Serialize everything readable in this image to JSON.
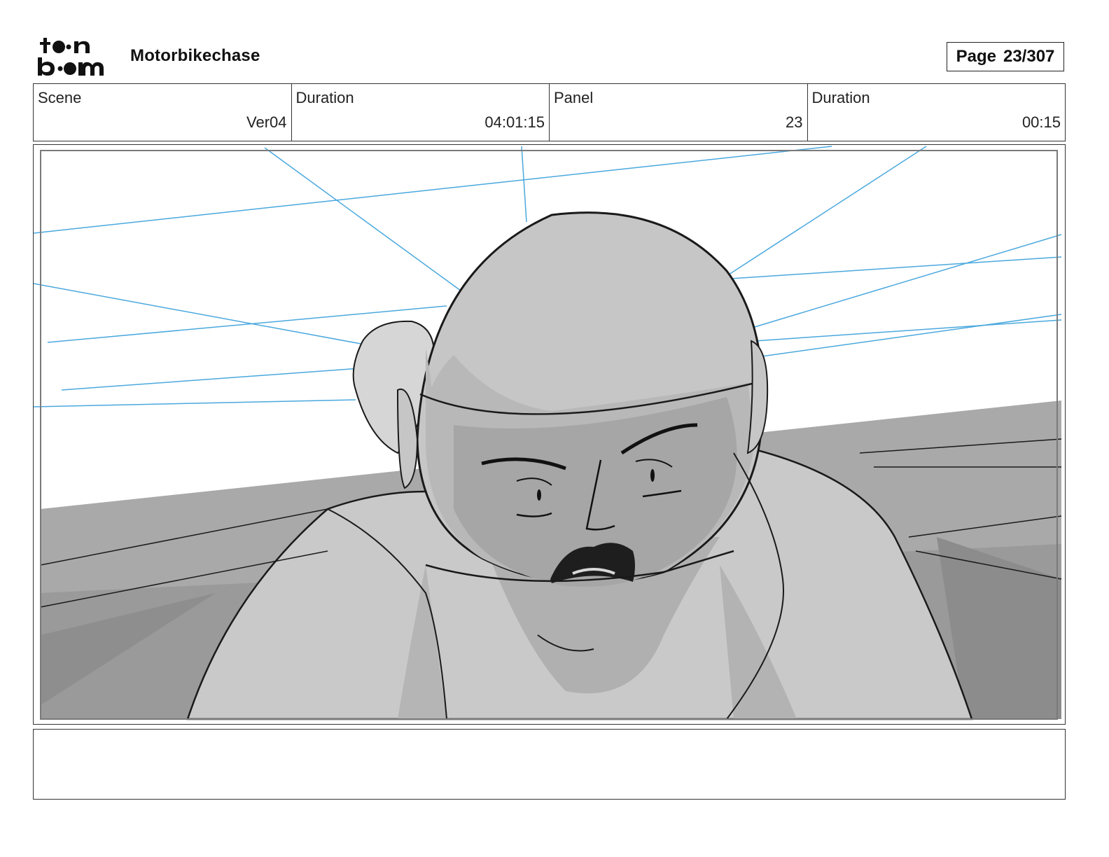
{
  "header": {
    "logo_text": "toon boom",
    "project_title": "Motorbikechase",
    "page_label": "Page",
    "page_number": "23/307"
  },
  "info": {
    "scene_label": "Scene",
    "scene_value": "Ver04",
    "scene_duration_label": "Duration",
    "scene_duration_value": "04:01:15",
    "panel_label": "Panel",
    "panel_value": "23",
    "panel_duration_label": "Duration",
    "panel_duration_value": "00:15"
  },
  "panel": {
    "image": "storyboard-sketch-motorbike-rider-helmet",
    "perspective_line_color": "#4aa8de"
  },
  "notes": {
    "text": ""
  }
}
